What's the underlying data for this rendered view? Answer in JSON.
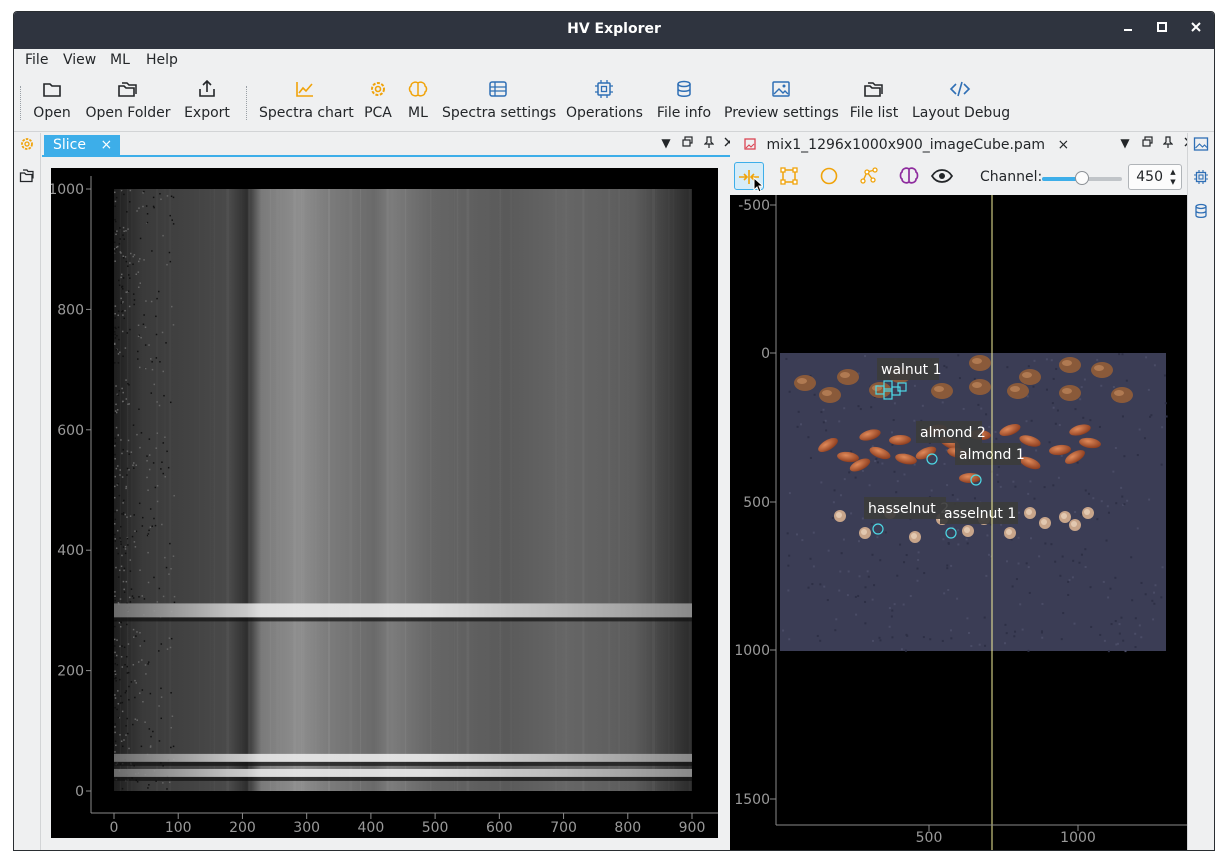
{
  "window": {
    "title": "HV Explorer",
    "controls": {
      "minimize": "–",
      "maximize": "□",
      "close": "×"
    }
  },
  "menubar": {
    "items": [
      "File",
      "View",
      "ML",
      "Help"
    ]
  },
  "toolbar": {
    "open": "Open",
    "open_folder": "Open Folder",
    "export": "Export",
    "spectra_chart": "Spectra chart",
    "pca": "PCA",
    "ml": "ML",
    "spectra_settings": "Spectra settings",
    "operations": "Operations",
    "file_info": "File info",
    "preview_settings": "Preview settings",
    "file_list": "File list",
    "layout_debug": "Layout Debug"
  },
  "colors": {
    "accent": "#3daee9",
    "orange_icon": "#f0a30a",
    "purple_icon": "#8e2c9e",
    "blue_icon": "#2f6fb5",
    "roi": "#4dd9e6",
    "cursor_line": "#f5f09a"
  },
  "slice_panel": {
    "tab_label": "Slice",
    "tab_close": "×",
    "chart": {
      "y_ticks": [
        "1000",
        "800",
        "600",
        "400",
        "200",
        "0"
      ],
      "x_ticks": [
        "0",
        "100",
        "200",
        "300",
        "400",
        "500",
        "600",
        "700",
        "800",
        "900"
      ]
    }
  },
  "image_panel": {
    "tab_label": "mix1_1296x1000x900_imageCube.pam",
    "tab_close": "×",
    "channel_label": "Channel:",
    "channel_value": "450",
    "channel_fraction": 0.5,
    "y_ticks": [
      "-500",
      "0",
      "500",
      "1000",
      "1500"
    ],
    "x_ticks": [
      "500",
      "1000"
    ],
    "roi_labels": [
      "walnut 1",
      "almond 2",
      "almond 1",
      "hasselnut 2",
      "asselnut 1"
    ]
  },
  "chart_data": {
    "type": "heatmap",
    "xlim": [
      0,
      900
    ],
    "ylim": [
      0,
      1000
    ],
    "x_ticks": [
      0,
      100,
      200,
      300,
      400,
      500,
      600,
      700,
      800,
      900
    ],
    "y_ticks": [
      0,
      200,
      400,
      600,
      800,
      1000
    ],
    "bright_bands_y": [
      30,
      55,
      300
    ],
    "bright_band_x_range": [
      210,
      640
    ],
    "title": "",
    "xlabel": "",
    "ylabel": ""
  }
}
